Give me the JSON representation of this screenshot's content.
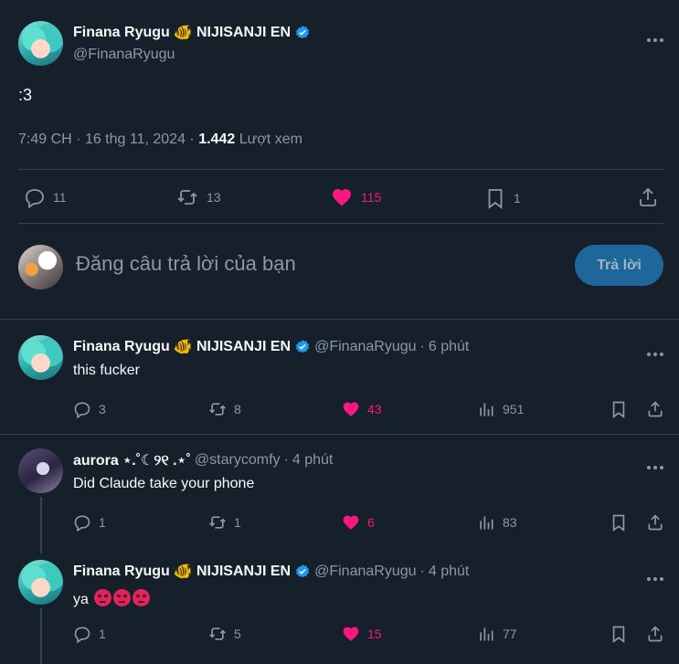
{
  "main_tweet": {
    "display_name": "Finana Ryugu",
    "fish_emoji": "🐠",
    "org": "NIJISANJI EN",
    "handle": "@FinanaRyugu",
    "text": ":3",
    "time": "7:49 CH",
    "sep1": "·",
    "date": "16 thg 11, 2024",
    "sep2": "·",
    "views": "1.442",
    "views_label": "Lượt xem",
    "replies": "11",
    "retweets": "13",
    "likes": "115",
    "bookmarks": "1"
  },
  "reply_box": {
    "placeholder": "Đăng câu trả lời của bạn",
    "button_label": "Trả lời"
  },
  "replies": [
    {
      "display_name": "Finana Ryugu",
      "fish_emoji": "🐠",
      "org": "NIJISANJI EN",
      "handle": "@FinanaRyugu",
      "sep": "·",
      "time_ago": "6 phút",
      "text": "this fucker",
      "replies": "3",
      "retweets": "8",
      "likes": "43",
      "views": "951"
    },
    {
      "display_name": "aurora ⋆.˚☾୨୧ .⋆˚",
      "handle": "@starycomfy",
      "sep": "·",
      "time_ago": "4 phút",
      "text": "Did Claude take your phone",
      "replies": "1",
      "retweets": "1",
      "likes": "6",
      "views": "83"
    },
    {
      "display_name": "Finana Ryugu",
      "fish_emoji": "🐠",
      "org": "NIJISANJI EN",
      "handle": "@FinanaRyugu",
      "sep": "·",
      "time_ago": "4 phút",
      "text": "ya",
      "replies": "1",
      "retweets": "5",
      "likes": "15",
      "views": "77"
    }
  ],
  "colors": {
    "background": "#15202b",
    "text": "#f7f9f9",
    "muted": "#8b98a5",
    "like": "#f91880",
    "verified": "#1d9bf0",
    "divider": "#38444d",
    "reply_button": "#1d679a"
  }
}
